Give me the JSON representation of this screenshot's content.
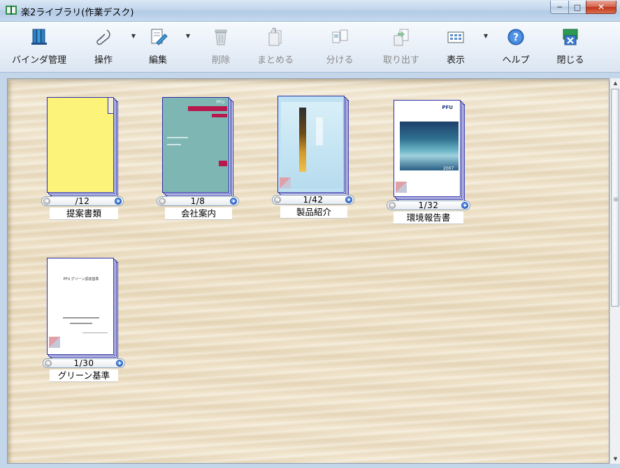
{
  "window": {
    "title": "楽2ライブラリ(作業デスク)",
    "controls": {
      "minimize": "─",
      "maximize": "□",
      "close": "✕"
    }
  },
  "toolbar": {
    "buttons": [
      {
        "label": "バインダ管理",
        "icon": "binder-manage-icon",
        "enabled": true,
        "dropdown": false
      },
      {
        "label": "操作",
        "icon": "operation-icon",
        "enabled": true,
        "dropdown": true
      },
      {
        "label": "編集",
        "icon": "edit-icon",
        "enabled": true,
        "dropdown": true
      },
      {
        "label": "削除",
        "icon": "trash-icon",
        "enabled": false,
        "dropdown": false
      },
      {
        "label": "まとめる",
        "icon": "combine-icon",
        "enabled": false,
        "dropdown": false
      },
      {
        "label": "分ける",
        "icon": "split-icon",
        "enabled": false,
        "dropdown": false
      },
      {
        "label": "取り出す",
        "icon": "extract-icon",
        "enabled": false,
        "dropdown": false
      },
      {
        "label": "表示",
        "icon": "view-icon",
        "enabled": true,
        "dropdown": true
      },
      {
        "label": "ヘルプ",
        "icon": "help-icon",
        "enabled": true,
        "dropdown": false
      },
      {
        "label": "閉じる",
        "icon": "close-app-icon",
        "enabled": true,
        "dropdown": false
      }
    ]
  },
  "binders": [
    {
      "name": "提案書類",
      "page": "/12",
      "cover": "yellow-folder"
    },
    {
      "name": "会社案内",
      "page": "1/8",
      "cover": "company-brochure",
      "cover_text": "PFU"
    },
    {
      "name": "製品紹介",
      "page": "1/42",
      "cover": "product-brochure"
    },
    {
      "name": "環境報告書",
      "page": "1/32",
      "cover": "environment-report",
      "cover_text": "PFU",
      "cover_year": "2007"
    },
    {
      "name": "グリーン基準",
      "page": "1/30",
      "cover": "green-standard-doc",
      "cover_text": "PFU グリーン調達基準"
    }
  ],
  "colors": {
    "binder_border": "#2a2fa8",
    "yellow_cover": "#fcf47a",
    "teal_cover": "#7db6b2",
    "sky_cover": "#bfe2f2",
    "accent_blue": "#1a56c8"
  }
}
